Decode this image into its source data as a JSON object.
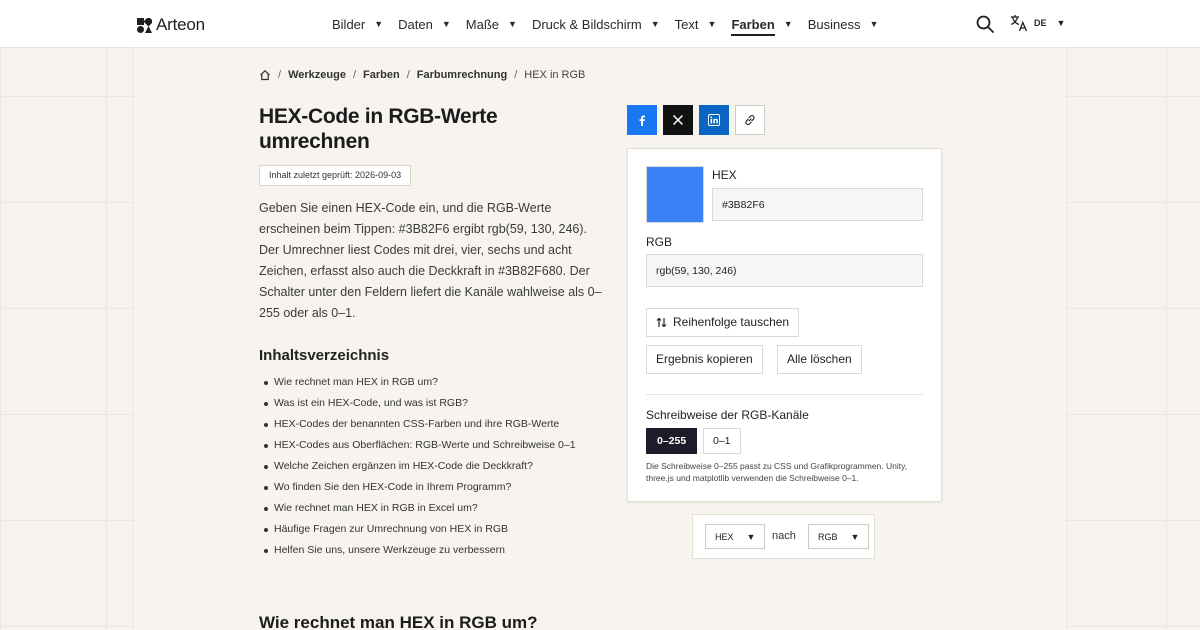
{
  "brand": {
    "name": "Arteon"
  },
  "nav": [
    {
      "label": "Bilder",
      "active": false
    },
    {
      "label": "Daten",
      "active": false
    },
    {
      "label": "Maße",
      "active": false
    },
    {
      "label": "Druck & Bildschirm",
      "active": false
    },
    {
      "label": "Text",
      "active": false
    },
    {
      "label": "Farben",
      "active": true
    },
    {
      "label": "Business",
      "active": false
    }
  ],
  "language": {
    "code": "DE"
  },
  "breadcrumb": {
    "items": [
      "Werkzeuge",
      "Farben",
      "Farbumrechnung"
    ],
    "current": "HEX in RGB"
  },
  "page": {
    "title": "HEX-Code in RGB-Werte umrechnen",
    "reviewed": "Inhalt zuletzt geprüft: 2026-09-03",
    "intro": "Geben Sie einen HEX-Code ein, und die RGB-Werte erscheinen beim Tippen: #3B82F6 ergibt rgb(59, 130, 246). Der Umrechner liest Codes mit drei, vier, sechs und acht Zeichen, erfasst also auch die Deckkraft in #3B82F680. Der Schalter unter den Feldern liefert die Kanäle wahlweise als 0–255 oder als 0–1.",
    "next_heading": "Wie rechnet man HEX in RGB um?"
  },
  "toc": {
    "title": "Inhaltsverzeichnis",
    "items": [
      "Wie rechnet man HEX in RGB um?",
      "Was ist ein HEX-Code, und was ist RGB?",
      "HEX-Codes der benannten CSS-Farben und ihre RGB-Werte",
      "HEX-Codes aus Oberflächen: RGB-Werte und Schreibweise 0–1",
      "Welche Zeichen ergänzen im HEX-Code die Deckkraft?",
      "Wo finden Sie den HEX-Code in Ihrem Programm?",
      "Wie rechnet man HEX in RGB in Excel um?",
      "Häufige Fragen zur Umrechnung von HEX in RGB",
      "Helfen Sie uns, unsere Werkzeuge zu verbessern"
    ]
  },
  "share": {
    "icons": [
      "facebook-icon",
      "x-icon",
      "linkedin-icon",
      "link-icon"
    ],
    "colors": {
      "facebook": "#1877f2",
      "x": "#111111",
      "linkedin": "#0a66c2"
    }
  },
  "converter": {
    "swatch_color": "#3B82F6",
    "hex_label": "HEX",
    "hex_value": "#3B82F6",
    "rgb_label": "RGB",
    "rgb_value": "rgb(59, 130, 246)",
    "swap_label": "Reihenfolge tauschen",
    "copy_label": "Ergebnis kopieren",
    "clear_label": "Alle löschen",
    "notation_label": "Schreibweise der RGB-Kanäle",
    "notation_options": [
      "0–255",
      "0–1"
    ],
    "notation_selected": "0–255",
    "hint": "Die Schreibweise 0–255 passt zu CSS und Grafikprogrammen. Unity, three.js und matplotlib verwenden die Schreibweise 0–1."
  },
  "fromto": {
    "from": "HEX",
    "to": "RGB",
    "connector": "nach"
  }
}
